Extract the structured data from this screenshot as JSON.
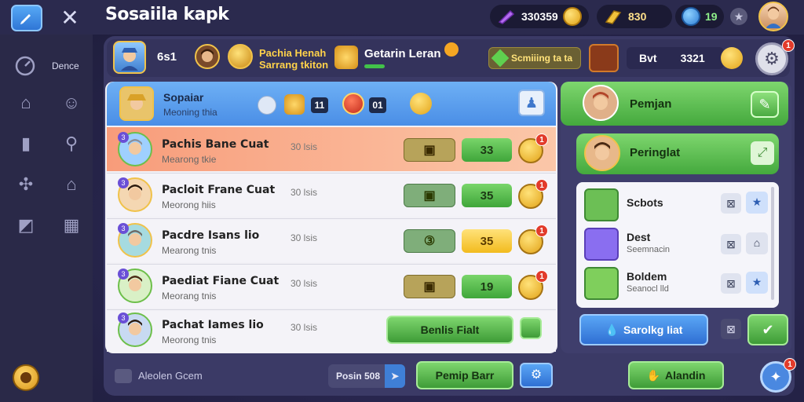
{
  "topbar": {
    "title": "Sosaiila kapk",
    "gems_value": "330359",
    "gold_value": "830",
    "level_value": "19"
  },
  "sidebar": {
    "items": [
      {
        "label": "Dence",
        "icon": "gauge-icon"
      },
      {
        "label": "",
        "icon": "house-icon"
      },
      {
        "label": "",
        "icon": "smile-icon"
      },
      {
        "label": "",
        "icon": "book-icon"
      },
      {
        "label": "",
        "icon": "search-icon"
      },
      {
        "label": "",
        "icon": "puzzle-icon"
      },
      {
        "label": "",
        "icon": "home-icon"
      },
      {
        "label": "",
        "icon": "chart-icon"
      },
      {
        "label": "",
        "icon": "grid-icon"
      }
    ]
  },
  "header": {
    "player_score": "6s1",
    "player_name_line1": "Pachia Henah",
    "player_name_line2": "Sarrang tkiton",
    "event_title": "Getarin Leran",
    "offer_label": "Scmiiing ta ta",
    "stat_label": "Bvt",
    "stat_value": "3321"
  },
  "left_panel": {
    "title": "Sopaiar",
    "subtitle": "Meoning thia",
    "stat1": "11",
    "stat2": "01",
    "rows": [
      {
        "name": "Pachis Bane Cuat",
        "sub": "Mearong tkie",
        "time": "30 lsis",
        "score": "33",
        "badge": "1"
      },
      {
        "name": "Pacloit Frane Cuat",
        "sub": "Meorong hiis",
        "time": "30 lsis",
        "score": "35",
        "badge": "1"
      },
      {
        "name": "Pacdre Isans lio",
        "sub": "Mearong tnis",
        "time": "30 lsis",
        "score": "35",
        "badge": "1"
      },
      {
        "name": "Paediat Fiane Cuat",
        "sub": "Meorang tnis",
        "time": "30 lsis",
        "score": "19",
        "badge": "1"
      },
      {
        "name": "Pachat Iames lio",
        "sub": "Meorong tnis",
        "time": "30 lsis",
        "score": "",
        "badge": ""
      }
    ],
    "action_button": "Benlis Fialt"
  },
  "right_panel": {
    "title": "Pemjan",
    "sub_title": "Peringlat",
    "items": [
      {
        "name": "Scbots",
        "sub": "",
        "icon": "hammer-icon"
      },
      {
        "name": "Dest",
        "sub": "Seemnacin",
        "icon": "wrench-icon"
      },
      {
        "name": "Boldem",
        "sub": "Seanocl lld",
        "icon": "pencil-icon"
      }
    ],
    "action_button": "Sarolkg Iiat"
  },
  "bottombar": {
    "chat_label": "Aleolen Gcem",
    "post_label": "Posin 508",
    "center_button": "Pemip Barr",
    "right_button": "Alandin",
    "corner_badge": "1"
  },
  "colors": {
    "accent_green": "#4fb444",
    "accent_blue": "#3f86e6",
    "highlight_row": "#f7a77c",
    "gold": "#f0bf2a"
  }
}
